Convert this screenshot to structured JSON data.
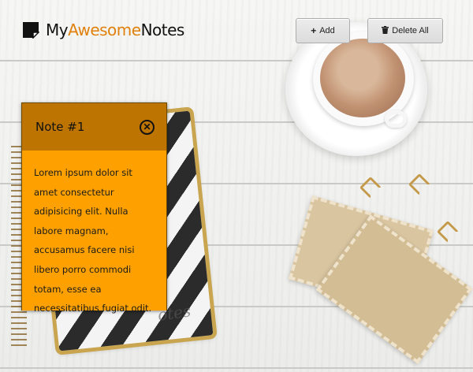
{
  "app": {
    "logo_prefix": "My",
    "logo_accent": "Awesome",
    "logo_suffix": "Notes"
  },
  "toolbar": {
    "add_label": "Add",
    "add_icon": "plus-icon",
    "delete_all_label": "Delete All",
    "delete_icon": "trash-icon"
  },
  "notes": [
    {
      "title": "Note #1",
      "body": "Lorem ipsum dolor sit amet consectetur adipisicing elit. Nulla labore magnam, accusamus facere nisi libero porro commodi totam, esse ea necessitatibus fugiat odit.",
      "close_icon": "close-circle-icon"
    }
  ],
  "colors": {
    "note_header": "#bd7400",
    "note_body": "#fea100",
    "logo_accent": "#e0810d"
  }
}
